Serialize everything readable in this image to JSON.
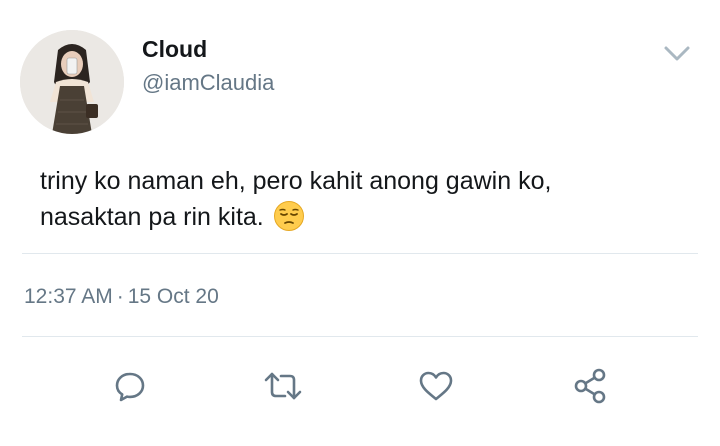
{
  "tweet": {
    "author": {
      "display_name": "Cloud",
      "handle": "@iamClaudia",
      "avatar_icon": "profile-photo"
    },
    "text_line1": "triny ko naman eh, pero kahit anong gawin ko,",
    "text_line2": "nasaktan pa rin kita.",
    "emoji": "pensive-face",
    "time": "12:37 AM",
    "separator": "·",
    "date": "15 Oct 20"
  },
  "actions": [
    {
      "name": "reply",
      "icon": "speech-bubble-icon"
    },
    {
      "name": "retweet",
      "icon": "retweet-arrows-icon"
    },
    {
      "name": "like",
      "icon": "heart-icon"
    },
    {
      "name": "share",
      "icon": "share-nodes-icon"
    }
  ],
  "colors": {
    "text_primary": "#14171a",
    "text_secondary": "#657786",
    "icon": "#657786",
    "divider": "#e1e8ed",
    "chevron": "#aab8c2"
  }
}
